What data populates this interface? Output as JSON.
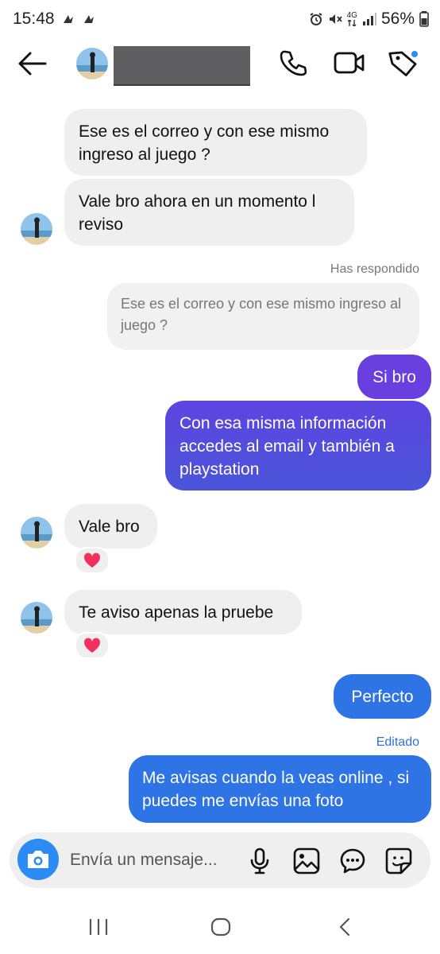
{
  "status": {
    "time": "15:48",
    "network": "4G",
    "battery": "56%"
  },
  "header": {
    "contact_name_redacted": true
  },
  "messages": {
    "m1": "Ese es el correo y con ese mismo ingreso al juego ?",
    "m2": "Vale bro ahora en un momento l reviso",
    "reply_label": "Has respondido",
    "quoted": "Ese es el correo y con ese mismo ingreso al juego ?",
    "m3": "Si bro",
    "m4": "Con esa misma información accedes al email y también a playstation",
    "m5": "Vale bro",
    "m6": "Te aviso apenas la pruebe",
    "m7": "Perfecto",
    "edited_label": "Editado",
    "m8": "Me avisas cuando la veas online , si puedes me envías una foto"
  },
  "composer": {
    "placeholder": "Envía un mensaje..."
  },
  "colors": {
    "purple_start": "#6a3fe0",
    "purple_end": "#4b53d9",
    "blue": "#2f74e4",
    "camera_blue": "#2b8cf6",
    "incoming": "#efefef"
  }
}
